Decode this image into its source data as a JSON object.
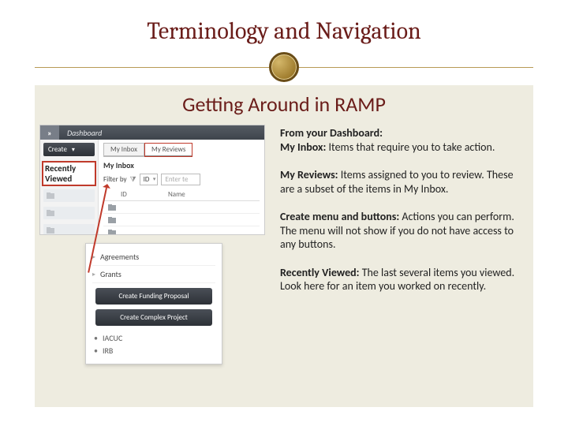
{
  "title": "Terminology and Navigation",
  "subtitle": "Getting Around in RAMP",
  "shot1": {
    "expand": "»",
    "topbar_item": "Dashboard",
    "create": "Create",
    "recently": "Recently Viewed",
    "tabs": {
      "inbox": "My Inbox",
      "reviews": "My Reviews"
    },
    "inbox_heading": "My Inbox",
    "filter_label": "Filter by",
    "filter_field": "ID",
    "filter_placeholder": "Enter te",
    "col_id": "ID",
    "col_name": "Name"
  },
  "shot2": {
    "cat1": "Agreements",
    "cat2": "Grants",
    "btn1": "Create Funding Proposal",
    "btn2": "Create Complex Project",
    "b1": "IACUC",
    "b2": "IRB"
  },
  "paras": {
    "p1_lead": "From your Dashboard:",
    "p1_key": "My Inbox:",
    "p1_rest": " Items that require you to take action.",
    "p2_key": "My Reviews:",
    "p2_rest": " Items assigned to you to review. These are a subset of the items in My Inbox.",
    "p3_key": "Create menu and buttons:",
    "p3_rest": " Actions you can perform. The menu will not show if you do not have access to any buttons.",
    "p4_key": "Recently Viewed:",
    "p4_rest": " The last several items you viewed. Look here for an item you worked on recently."
  }
}
